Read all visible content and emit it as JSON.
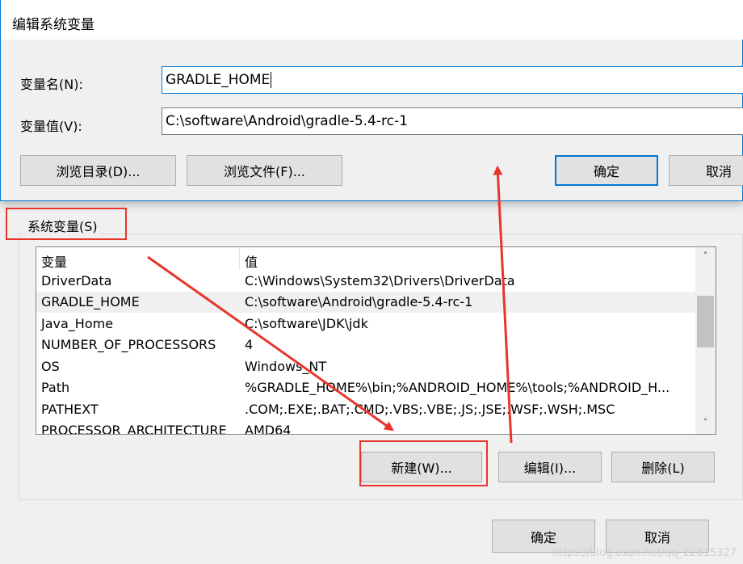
{
  "front_dialog": {
    "title": "编辑系统变量",
    "name_label": "变量名(N):",
    "value_label": "变量值(V):",
    "name_value": "GRADLE_HOME",
    "value_value": "C:\\software\\Android\\gradle-5.4-rc-1",
    "browse_dir_label": "浏览目录(D)...",
    "browse_file_label": "浏览文件(F)...",
    "ok_label": "确定",
    "cancel_label": "取消",
    "accent_color": "#0078d7"
  },
  "system_vars": {
    "group_title": "系统变量(S)",
    "columns": [
      "变量",
      "值"
    ],
    "rows": [
      {
        "name": "DriverData",
        "value": "C:\\Windows\\System32\\Drivers\\DriverData"
      },
      {
        "name": "GRADLE_HOME",
        "value": "C:\\software\\Android\\gradle-5.4-rc-1"
      },
      {
        "name": "Java_Home",
        "value": "C:\\software\\JDK\\jdk"
      },
      {
        "name": "NUMBER_OF_PROCESSORS",
        "value": "4"
      },
      {
        "name": "OS",
        "value": "Windows_NT"
      },
      {
        "name": "Path",
        "value": "%GRADLE_HOME%\\bin;%ANDROID_HOME%\\tools;%ANDROID_H..."
      },
      {
        "name": "PATHEXT",
        "value": ".COM;.EXE;.BAT;.CMD;.VBS;.VBE;.JS;.JSE;.WSF;.WSH;.MSC"
      },
      {
        "name": "PROCESSOR_ARCHITECTURE",
        "value": "AMD64"
      }
    ],
    "selected_row": "GRADLE_HOME",
    "new_label": "新建(W)...",
    "edit_label": "编辑(I)...",
    "delete_label": "删除(L)"
  },
  "back_dialog": {
    "ok_label": "确定",
    "cancel_label": "取消"
  },
  "annotations": {
    "color": "#e8352c"
  },
  "watermark": "https://blog.csdn.net/qq_22815327"
}
